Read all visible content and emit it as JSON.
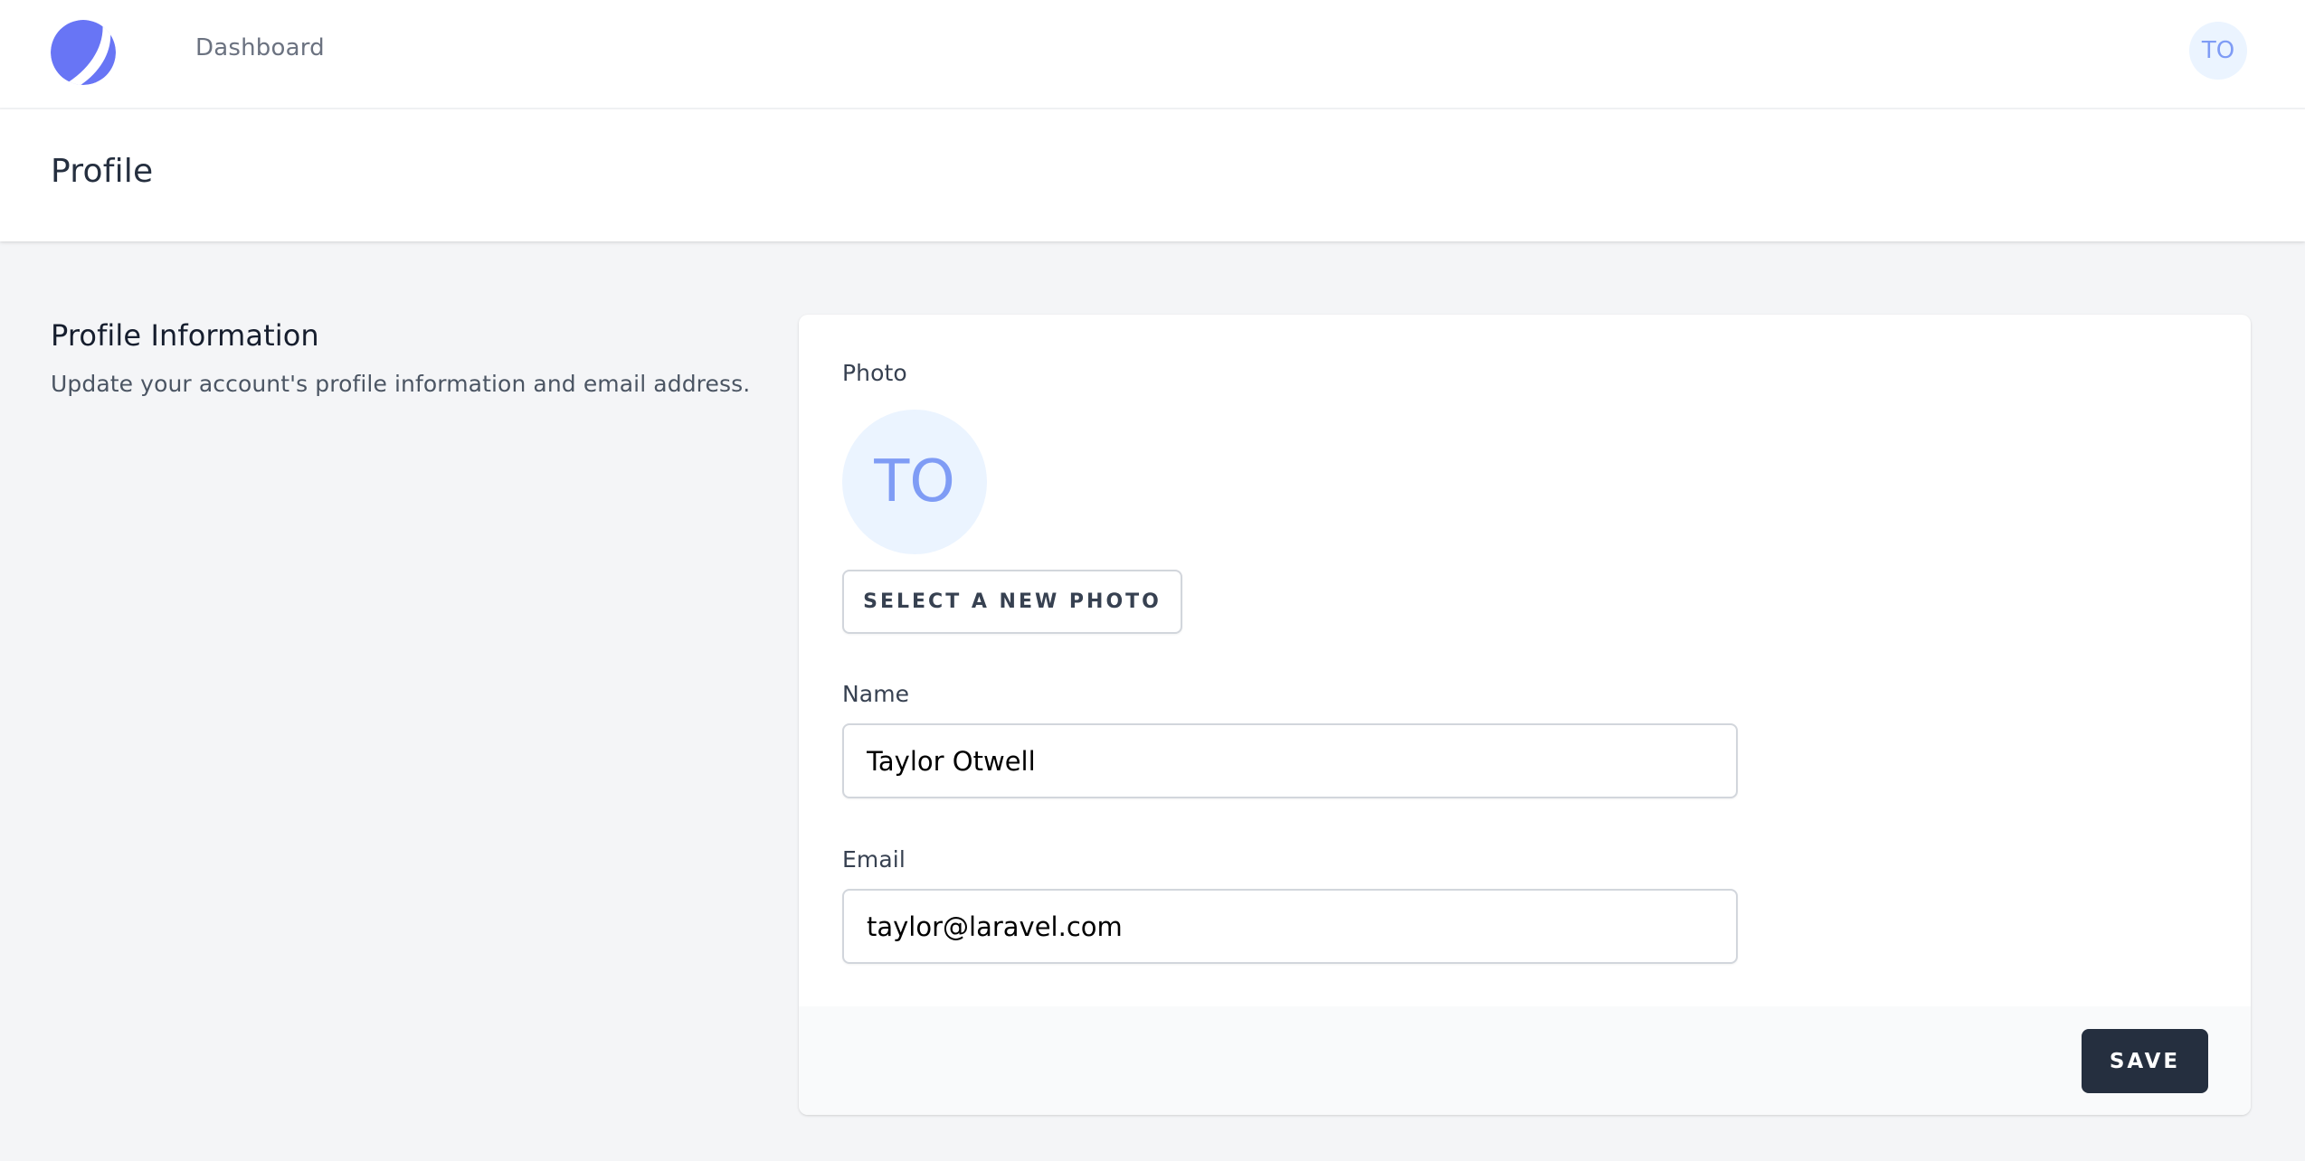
{
  "nav": {
    "logo_color": "#6875f5",
    "links": [
      {
        "label": "Dashboard"
      }
    ],
    "user_initials": "TO"
  },
  "page": {
    "title": "Profile"
  },
  "section": {
    "title": "Profile Information",
    "description": "Update your account's profile information and email address."
  },
  "form": {
    "photo": {
      "label": "Photo",
      "initials": "TO",
      "select_button": "SELECT A NEW PHOTO"
    },
    "name": {
      "label": "Name",
      "value": "Taylor Otwell"
    },
    "email": {
      "label": "Email",
      "value": "taylor@laravel.com"
    },
    "save_button": "SAVE"
  },
  "colors": {
    "accent": "#6875f5",
    "avatar_bg": "#ebf4ff",
    "avatar_text": "#7f9cf5",
    "primary_button": "#252f3f",
    "page_bg": "#f4f5f7"
  }
}
